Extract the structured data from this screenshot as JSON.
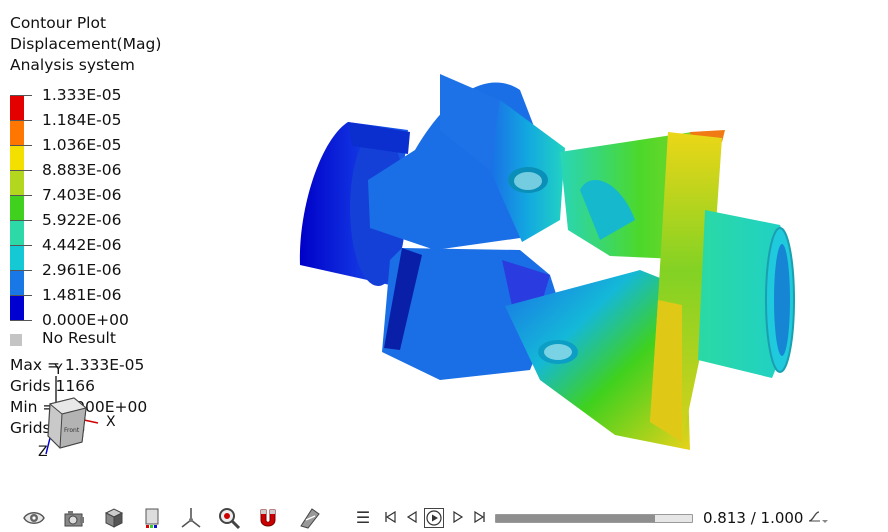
{
  "header": {
    "line1": "Contour Plot",
    "line2": "Displacement(Mag)",
    "line3": "Analysis system"
  },
  "legend": {
    "colors": [
      "#e50000",
      "#ff7700",
      "#f3e000",
      "#b3d61f",
      "#3fd11e",
      "#2ed9a8",
      "#15c9d4",
      "#1a78e6",
      "#0000d0"
    ],
    "labels": [
      "1.333E-05",
      "1.184E-05",
      "1.036E-05",
      "8.883E-06",
      "7.403E-06",
      "5.922E-06",
      "4.442E-06",
      "2.961E-06",
      "1.481E-06",
      "0.000E+00"
    ],
    "no_result": "No Result"
  },
  "stats": {
    "max": "Max = 1.333E-05",
    "max_grid": "Grids 1166",
    "min": "Min = 0.000E+00",
    "min_grid": "Grids 714"
  },
  "triad": {
    "x": "X",
    "y": "Y",
    "z": "Z",
    "face": "Front"
  },
  "toolbar": {
    "icons": [
      "eye-icon",
      "camera-icon",
      "cube-view-icon",
      "color-legend-icon",
      "axis-triad-icon",
      "zoom-icon",
      "magnet-icon",
      "section-cut-icon"
    ]
  },
  "animation": {
    "progress": 0.813,
    "frame_text": "0.813 / 1.000"
  }
}
